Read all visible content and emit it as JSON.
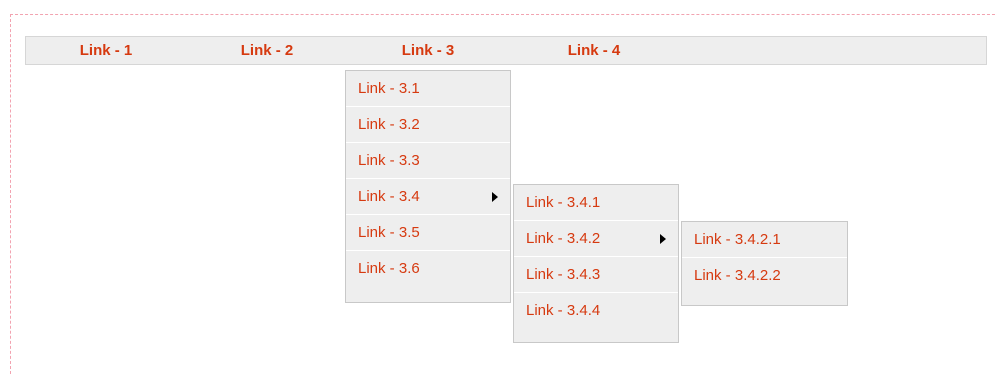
{
  "menubar": {
    "items": [
      {
        "label": "Link - 1"
      },
      {
        "label": "Link - 2"
      },
      {
        "label": "Link - 3"
      },
      {
        "label": "Link - 4"
      }
    ]
  },
  "submenu_3": {
    "items": [
      {
        "label": "Link - 3.1"
      },
      {
        "label": "Link - 3.2"
      },
      {
        "label": "Link - 3.3"
      },
      {
        "label": "Link - 3.4",
        "has_submenu": true
      },
      {
        "label": "Link - 3.5"
      },
      {
        "label": "Link - 3.6"
      }
    ]
  },
  "submenu_3_4": {
    "items": [
      {
        "label": "Link - 3.4.1"
      },
      {
        "label": "Link - 3.4.2",
        "has_submenu": true
      },
      {
        "label": "Link - 3.4.3"
      },
      {
        "label": "Link - 3.4.4"
      }
    ]
  },
  "submenu_3_4_2": {
    "items": [
      {
        "label": "Link - 3.4.2.1"
      },
      {
        "label": "Link - 3.4.2.2"
      }
    ]
  },
  "colors": {
    "link": "#d63a10",
    "menu_bg": "#eeeeee",
    "border": "#c8c8c8",
    "frame_dash": "#f2a3b0"
  },
  "icons": {
    "submenu_indicator": "caret-right-icon"
  }
}
